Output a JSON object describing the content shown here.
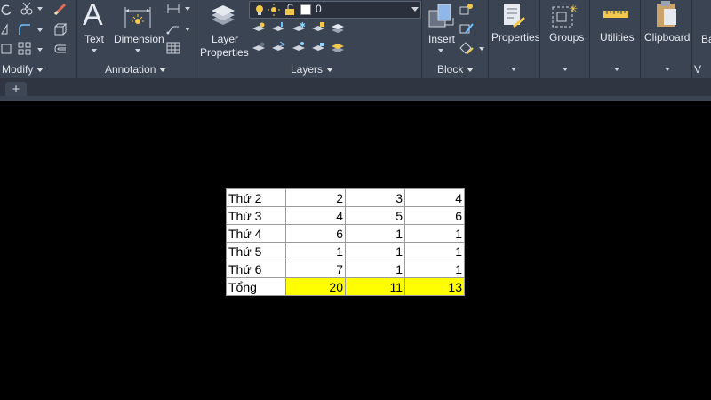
{
  "ribbon": {
    "panels": {
      "modify": "Modify",
      "annotation": "Annotation",
      "layers": "Layers",
      "block": "Block",
      "properties": "Properties",
      "groups": "Groups",
      "utilities": "Utilities",
      "clipboard": "Clipboard",
      "view_cut": "V"
    },
    "buttons": {
      "text": "Text",
      "dimension": "Dimension",
      "layer_properties_line1": "Layer",
      "layer_properties_line2": "Properties",
      "insert": "Insert",
      "properties": "Properties",
      "groups": "Groups",
      "utilities": "Utilities",
      "clipboard": "Clipboard",
      "ba_cut": "Ba"
    },
    "layer_combo": {
      "value": "0"
    }
  },
  "tabs": {
    "new_tab": "+"
  },
  "colors": {
    "ribbon_bg": "#3b4453",
    "canvas_bg": "#000000",
    "total_highlight": "#ffff00"
  },
  "table": {
    "rows": [
      {
        "label": "Thứ 2",
        "values": [
          "2",
          "3",
          "4"
        ]
      },
      {
        "label": "Thứ 3",
        "values": [
          "4",
          "5",
          "6"
        ]
      },
      {
        "label": "Thứ 4",
        "values": [
          "6",
          "1",
          "1"
        ]
      },
      {
        "label": "Thứ 5",
        "values": [
          "1",
          "1",
          "1"
        ]
      },
      {
        "label": "Thứ 6",
        "values": [
          "7",
          "1",
          "1"
        ]
      }
    ],
    "total": {
      "label": "Tổng",
      "values": [
        "20",
        "11",
        "13"
      ]
    }
  }
}
